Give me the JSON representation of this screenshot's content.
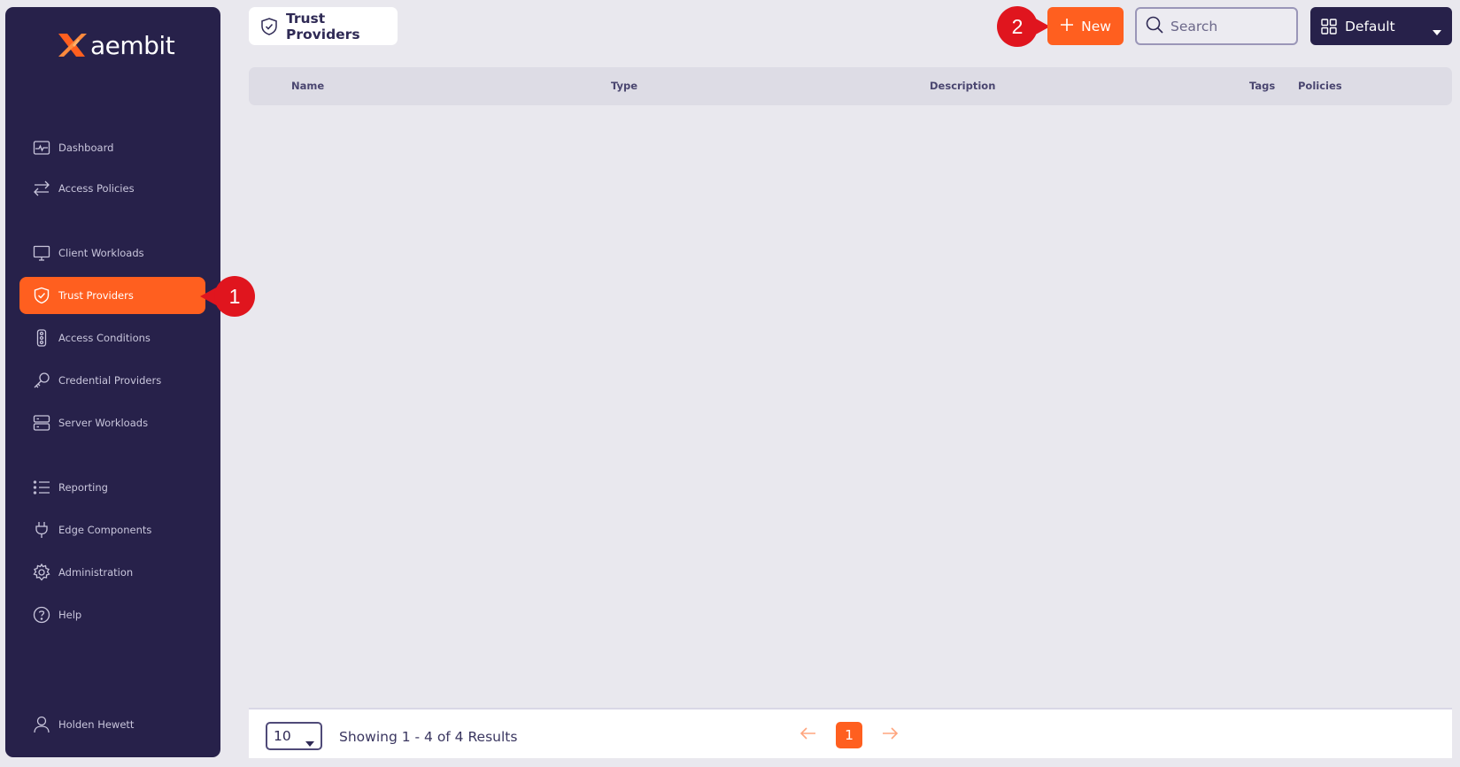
{
  "brand": {
    "name": "aembit",
    "accent": "#ff5f1f",
    "sidebar_bg": "#27214a"
  },
  "sidebar": {
    "items": [
      {
        "label": "Dashboard",
        "icon": "dashboard-icon"
      },
      {
        "label": "Access Policies",
        "icon": "arrows-exchange-icon"
      },
      {
        "label": "Client Workloads",
        "icon": "monitor-icon"
      },
      {
        "label": "Trust Providers",
        "icon": "shield-check-icon",
        "active": true
      },
      {
        "label": "Access Conditions",
        "icon": "traffic-light-icon"
      },
      {
        "label": "Credential Providers",
        "icon": "key-icon"
      },
      {
        "label": "Server Workloads",
        "icon": "server-icon"
      },
      {
        "label": "Reporting",
        "icon": "list-icon"
      },
      {
        "label": "Edge Components",
        "icon": "plug-icon"
      },
      {
        "label": "Administration",
        "icon": "gear-icon"
      },
      {
        "label": "Help",
        "icon": "help-circle-icon"
      }
    ],
    "user": {
      "name": "Holden Hewett",
      "icon": "user-icon"
    }
  },
  "header": {
    "title": "Trust Providers",
    "new_label": "New",
    "search_placeholder": "Search",
    "view_select": "Default"
  },
  "table": {
    "columns": [
      "Name",
      "Type",
      "Description",
      "Tags",
      "Policies"
    ]
  },
  "footer": {
    "page_size": "10",
    "results_text": "Showing 1 - 4 of 4 Results",
    "current_page": "1"
  },
  "callouts": [
    "1",
    "2"
  ]
}
